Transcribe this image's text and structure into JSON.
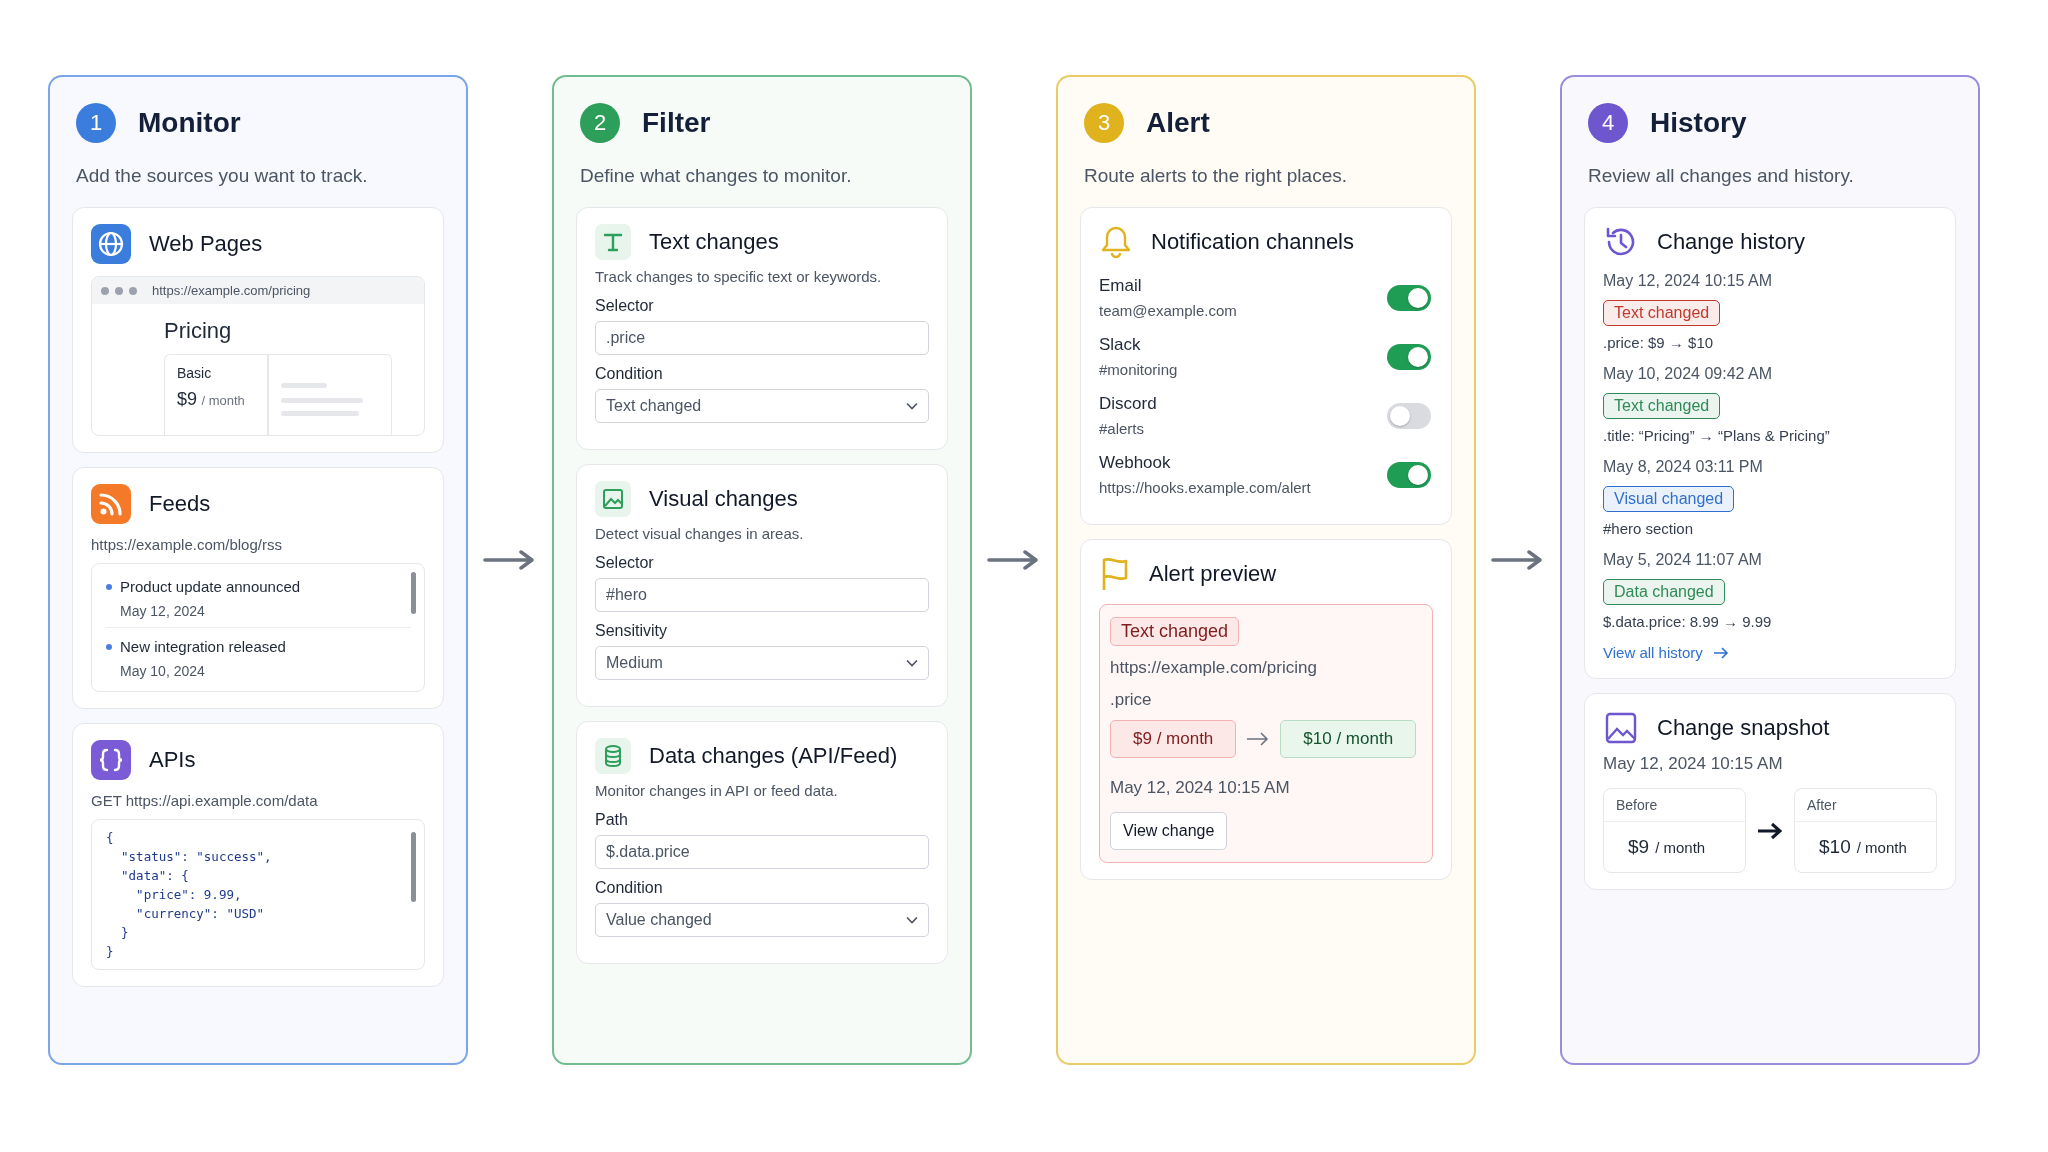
{
  "steps": [
    {
      "number": "1",
      "title": "Monitor",
      "subtitle": "Add the sources you want to track.",
      "color": "#3b7ddd",
      "cards": [
        {
          "kind": "webpage",
          "title": "Web Pages",
          "url": "https://example.com/pricing",
          "heading": "Pricing",
          "plan": "Basic",
          "price": "$9",
          "period": "/ month"
        },
        {
          "kind": "feed",
          "title": "Feeds",
          "url": "https://example.com/blog/rss",
          "items": [
            {
              "title": "Product update announced",
              "date": "May 12, 2024"
            },
            {
              "title": "New integration released",
              "date": "May 10, 2024"
            }
          ]
        },
        {
          "kind": "api",
          "title": "APIs",
          "method": "GET",
          "url": "https://api.example.com/data",
          "code": [
            "{",
            "  \"status\": \"success\",",
            "  \"data\": {",
            "    \"price\": 9.99,",
            "    \"currency\": \"USD\"",
            "  }",
            "}"
          ]
        }
      ]
    },
    {
      "number": "2",
      "title": "Filter",
      "subtitle": "Define what changes to monitor.",
      "color": "#2e9e5b",
      "cards": [
        {
          "kind": "text",
          "title": "Text changes",
          "description": "Track changes to specific text or keywords.",
          "fields": [
            {
              "label": "Selector",
              "value": ".price",
              "kind": "input"
            },
            {
              "label": "Condition",
              "value": "Text changed",
              "kind": "select"
            }
          ]
        },
        {
          "kind": "visual",
          "title": "Visual changes",
          "description": "Detect visual changes in areas.",
          "fields": [
            {
              "label": "Selector",
              "value": "#hero",
              "kind": "input"
            },
            {
              "label": "Sensitivity",
              "value": "Medium",
              "kind": "select"
            }
          ]
        },
        {
          "kind": "data",
          "title": "Data changes (API/Feed)",
          "description": "Monitor changes in API or feed data.",
          "fields": [
            {
              "label": "Path",
              "value": "$.data.price",
              "kind": "input"
            },
            {
              "label": "Condition",
              "value": "Value changed",
              "kind": "select"
            }
          ]
        }
      ]
    },
    {
      "number": "3",
      "title": "Alert",
      "subtitle": "Route alerts to the right places.",
      "color": "#e0b21e",
      "cards": [
        {
          "kind": "channels",
          "title": "Notification channels",
          "channels": [
            {
              "name": "Email",
              "detail": "team@example.com",
              "on": true
            },
            {
              "name": "Slack",
              "detail": "#monitoring",
              "on": true
            },
            {
              "name": "Discord",
              "detail": "#alerts",
              "on": false
            },
            {
              "name": "Webhook",
              "detail": "https://hooks.example.com/alert",
              "on": true
            }
          ]
        },
        {
          "kind": "preview",
          "title": "Alert preview",
          "tag": "Text changed",
          "url": "https://example.com/pricing",
          "selector": ".price",
          "before": "$9 / month",
          "after": "$10 / month",
          "time": "May 12, 2024 10:15 AM",
          "button": "View change"
        }
      ]
    },
    {
      "number": "4",
      "title": "History",
      "subtitle": "Review all changes and history.",
      "color": "#6e56cf",
      "cards": [
        {
          "kind": "history",
          "title": "Change history",
          "entries": [
            {
              "time": "May 12, 2024 10:15 AM",
              "tag": "Text changed",
              "color": "#c0392b",
              "detail": ".price: $9 → $10"
            },
            {
              "time": "May 10, 2024 09:42 AM",
              "tag": "Text changed",
              "color": "#2e8b57",
              "detail": ".title: “Pricing” → “Plans & Pricing”"
            },
            {
              "time": "May 8, 2024 03:11 PM",
              "tag": "Visual changed",
              "color": "#2f6fd0",
              "detail": "#hero section"
            },
            {
              "time": "May 5, 2024 11:07 AM",
              "tag": "Data changed",
              "color": "#2e8b57",
              "detail": "$.data.price: 8.99 → 9.99"
            }
          ],
          "link": "View all history"
        },
        {
          "kind": "snapshot",
          "title": "Change snapshot",
          "time": "May 12, 2024 10:15 AM",
          "before": {
            "label": "Before",
            "price": "$9",
            "period": "/ month"
          },
          "after": {
            "label": "After",
            "price": "$10",
            "period": "/ month"
          }
        }
      ]
    }
  ]
}
